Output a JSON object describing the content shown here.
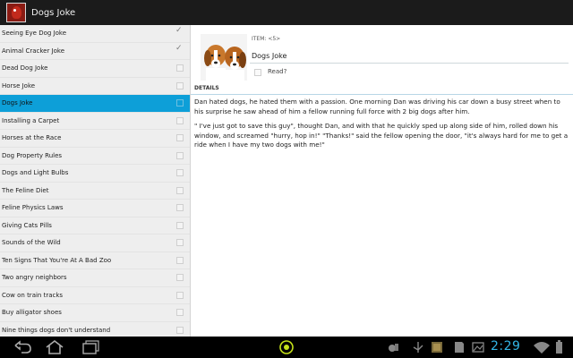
{
  "app": {
    "title": "Dogs Joke",
    "icon": "app-logo-icon"
  },
  "jokes": [
    {
      "label": "Seeing Eye Dog Joke",
      "checked": true
    },
    {
      "label": "Animal Cracker Joke",
      "checked": true
    },
    {
      "label": "Dead Dog Joke",
      "checked": false
    },
    {
      "label": "Horse Joke",
      "checked": false
    },
    {
      "label": "Dogs Joke",
      "checked": false,
      "selected": true
    },
    {
      "label": "Installing a Carpet",
      "checked": false
    },
    {
      "label": "Horses at the Race",
      "checked": false
    },
    {
      "label": "Dog Property Rules",
      "checked": false
    },
    {
      "label": "Dogs and Light Bulbs",
      "checked": false
    },
    {
      "label": "The Feline Diet",
      "checked": false
    },
    {
      "label": "Feline Physics Laws",
      "checked": false
    },
    {
      "label": "Giving Cats Pills",
      "checked": false
    },
    {
      "label": "Sounds of the Wild",
      "checked": false
    },
    {
      "label": "Ten Signs That You're At A Bad Zoo",
      "checked": false
    },
    {
      "label": "Two angry neighbors",
      "checked": false
    },
    {
      "label": "Cow on train tracks",
      "checked": false
    },
    {
      "label": "Buy alligator shoes",
      "checked": false
    },
    {
      "label": "Nine things dogs don't understand",
      "checked": false
    }
  ],
  "detail": {
    "item_label": "ITEM: <5>",
    "title": "Dogs Joke",
    "read_label": "Read?",
    "read_checked": false,
    "section_header": "DETAILS",
    "paragraphs": [
      "Dan hated dogs, he hated them with a passion. One morning Dan was driving his car down a busy street when to his surprise he saw ahead of him a fellow running full force with 2 big dogs after him.",
      "\" I've just got to save this guy\", thought Dan, and with that he quickly sped up along side of him, rolled down his window, and screamed \"hurry, hop in!\" \"Thanks!\" said the fellow opening the door, \"it's always hard for me to get a ride when I have my two dogs with me!\""
    ]
  },
  "navbar": {
    "back_icon": "back-icon",
    "home_icon": "home-icon",
    "recents_icon": "recent-apps-icon",
    "center_icon": "launcher-icon",
    "time": "2:29"
  },
  "colors": {
    "accent": "#0d9fd8",
    "clock": "#33b5e5"
  }
}
